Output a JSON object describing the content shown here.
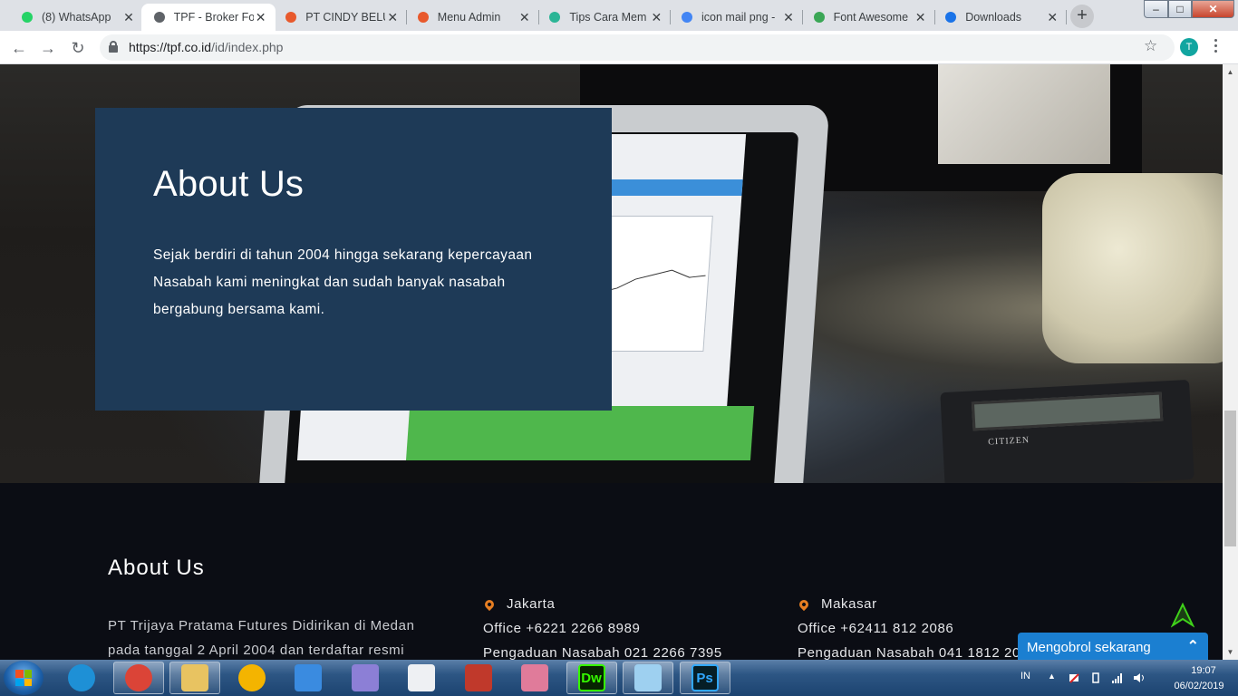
{
  "browser": {
    "tabs": [
      {
        "title": "(8) WhatsApp",
        "favicon": "whatsapp-icon",
        "color": "#25d366",
        "active": false
      },
      {
        "title": "TPF - Broker Fo",
        "favicon": "page-icon",
        "color": "#5f6368",
        "active": true
      },
      {
        "title": "PT CINDY BELU",
        "favicon": "xampp-icon",
        "color": "#e8592c",
        "active": false
      },
      {
        "title": "Menu Admin",
        "favicon": "xampp-icon",
        "color": "#e8592c",
        "active": false
      },
      {
        "title": "Tips Cara Mem",
        "favicon": "wave-icon",
        "color": "#2bb596",
        "active": false
      },
      {
        "title": "icon mail png -",
        "favicon": "google-icon",
        "color": "#4285f4",
        "active": false
      },
      {
        "title": "Font Awesome",
        "favicon": "font-awesome-icon",
        "color": "#3aa655",
        "active": false
      },
      {
        "title": "Downloads",
        "favicon": "download-icon",
        "color": "#1a73e8",
        "active": false
      }
    ],
    "url_host": "https://tpf.co.id",
    "url_path": "/id/index.php",
    "profile_initial": "T"
  },
  "hero": {
    "title": "About Us",
    "text": "Sejak berdiri di tahun 2004 hingga sekarang kepercayaan Nasabah kami meningkat dan sudah banyak nasabah bergabung bersama kami.",
    "calc_brand": "CITIZEN"
  },
  "footer": {
    "about_title": "About Us",
    "about_text": "PT Trijaya Pratama Futures Didirikan di Medan pada tanggal 2 April 2004 dan terdaftar resmi",
    "offices": [
      {
        "city": "Jakarta",
        "office": "Office +6221 2266 8989",
        "complaint": "Pengaduan Nasabah 021 2266 7395"
      },
      {
        "city": "Makasar",
        "office": "Office +62411 812 2086",
        "complaint": "Pengaduan Nasabah 041 1812 2086"
      }
    ],
    "accent_color": "#e67e22"
  },
  "chat": {
    "label": "Mengobrol sekarang"
  },
  "taskbar": {
    "apps": [
      {
        "name": "internet-explorer-icon",
        "color": "#1e90d6",
        "running": false
      },
      {
        "name": "chrome-icon",
        "color": "#db4437",
        "running": true
      },
      {
        "name": "file-explorer-icon",
        "color": "#e8c361",
        "running": true
      },
      {
        "name": "chrome-icon",
        "color": "#f4b400",
        "running": false
      },
      {
        "name": "app-icon",
        "color": "#3a8be0",
        "running": false
      },
      {
        "name": "game-icon",
        "color": "#8c7fd6",
        "running": false
      },
      {
        "name": "solitaire-icon",
        "color": "#eef0f3",
        "running": false
      },
      {
        "name": "game-icon",
        "color": "#c0392b",
        "running": false
      },
      {
        "name": "game-icon",
        "color": "#e07b9a",
        "running": false
      },
      {
        "name": "dreamweaver-icon",
        "color": "#35fa00",
        "running": true
      },
      {
        "name": "notepad-icon",
        "color": "#9ed0f0",
        "running": true
      },
      {
        "name": "photoshop-icon",
        "color": "#31a8ff",
        "running": true
      }
    ],
    "dreamweaver_label": "Dw",
    "photoshop_label": "Ps",
    "lang": "IN",
    "time": "19:07",
    "date": "06/02/2019"
  }
}
